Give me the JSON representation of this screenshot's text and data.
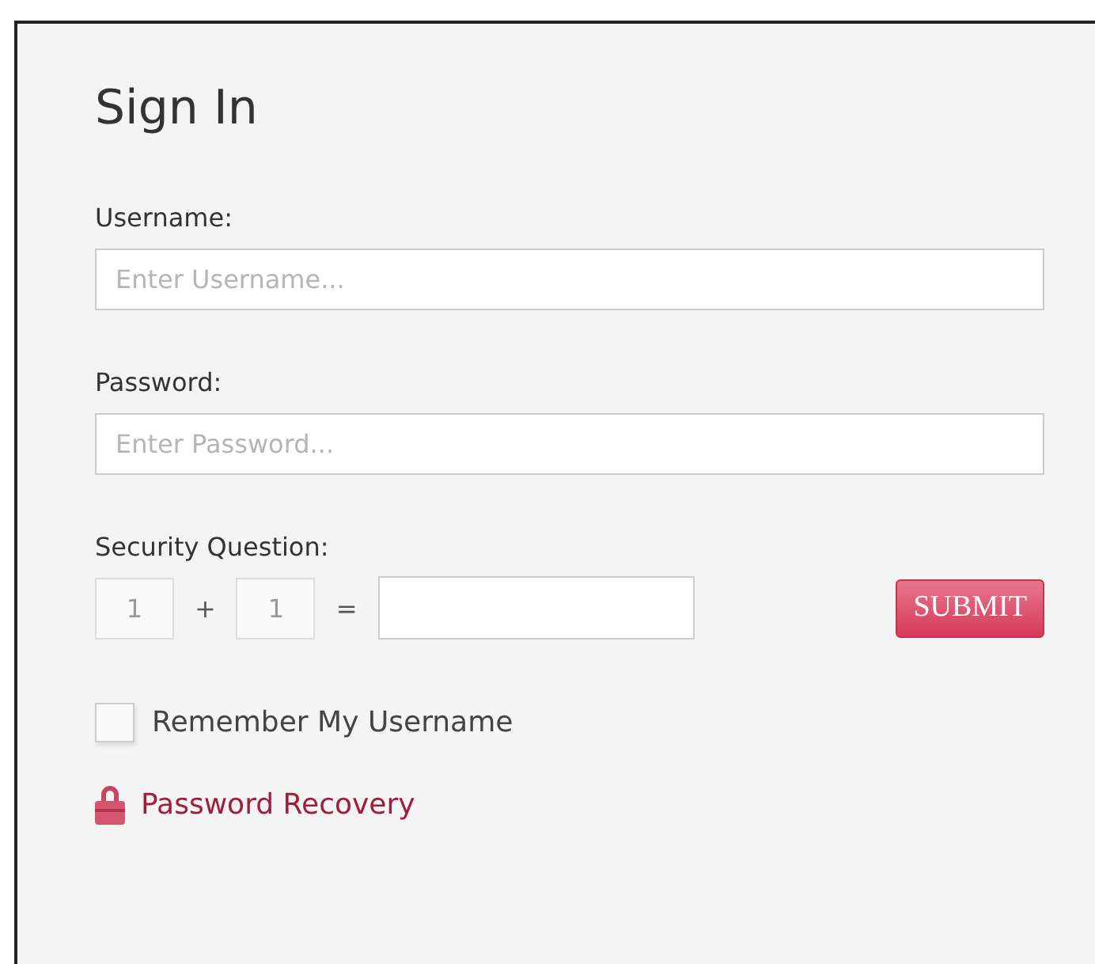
{
  "title": "Sign In",
  "fields": [
    {
      "label": "Username:",
      "placeholder": "Enter Username..."
    },
    {
      "label": "Password:",
      "placeholder": "Enter Password..."
    }
  ],
  "security_question": {
    "label": "Security Question:",
    "operand_1": "1",
    "operator": "+",
    "operand_2": "1",
    "equals": "="
  },
  "submit_button": "SUBMIT",
  "remember": {
    "label": "Remember My Username",
    "checked": false
  },
  "recovery_link": "Password Recovery"
}
